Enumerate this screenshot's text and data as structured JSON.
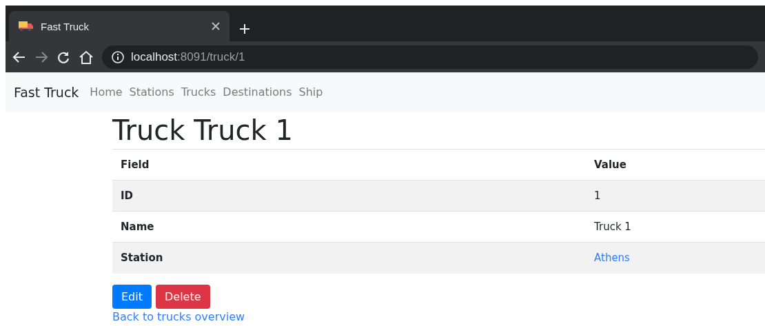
{
  "browser": {
    "tab": {
      "title": "Fast Truck"
    },
    "address": {
      "host": "localhost",
      "path": ":8091/truck/1"
    }
  },
  "navbar": {
    "brand": "Fast Truck",
    "links": [
      "Home",
      "Stations",
      "Trucks",
      "Destinations",
      "Ship"
    ]
  },
  "heading": "Truck Truck 1",
  "table": {
    "columns": [
      "Field",
      "Value"
    ],
    "rows": [
      {
        "field": "ID",
        "value": "1",
        "kind": "text"
      },
      {
        "field": "Name",
        "value": "Truck 1",
        "kind": "text"
      },
      {
        "field": "Station",
        "value": "Athens",
        "kind": "link"
      }
    ]
  },
  "buttons": [
    {
      "label": "Edit",
      "kind": "primary"
    },
    {
      "label": "Delete",
      "kind": "danger"
    }
  ],
  "back_link": "Back to trucks overview"
}
